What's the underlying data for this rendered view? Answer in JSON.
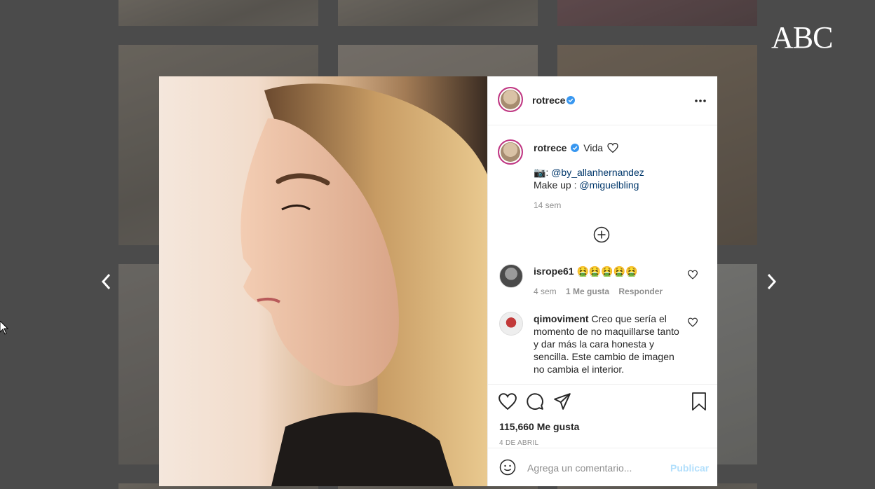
{
  "brand": {
    "logo_text": "ABC"
  },
  "post": {
    "username": "rotrece",
    "caption": {
      "username": "rotrece",
      "word": "Vida",
      "line1_prefix": "📷: ",
      "line1_mention": "@by_allanhernandez",
      "line2_prefix": "Make up : ",
      "line2_mention": "@miguelbling",
      "time": "14 sem"
    },
    "comments": [
      {
        "username": "isrope61",
        "text": "🤮🤮🤮🤮🤮",
        "time": "4 sem",
        "likes": "1 Me gusta",
        "reply": "Responder"
      },
      {
        "username": "qimoviment",
        "text": "Creo que sería el momento de no maquillarse tanto y dar más la cara honesta y sencilla. Este cambio de imagen no cambia el interior."
      }
    ],
    "likes_label": "115,660 Me gusta",
    "date": "4 DE ABRIL"
  },
  "comment_box": {
    "placeholder": "Agrega un comentario...",
    "publish_label": "Publicar"
  },
  "colors": {
    "verified": "#3897f0",
    "link": "#00376b",
    "publish": "#b2dffc"
  },
  "icons": [
    "more-icon",
    "heart-icon",
    "comment-icon",
    "share-icon",
    "bookmark-icon",
    "plus-circle-icon",
    "emoji-icon",
    "chevron-left-icon",
    "chevron-right-icon",
    "verified-icon"
  ]
}
